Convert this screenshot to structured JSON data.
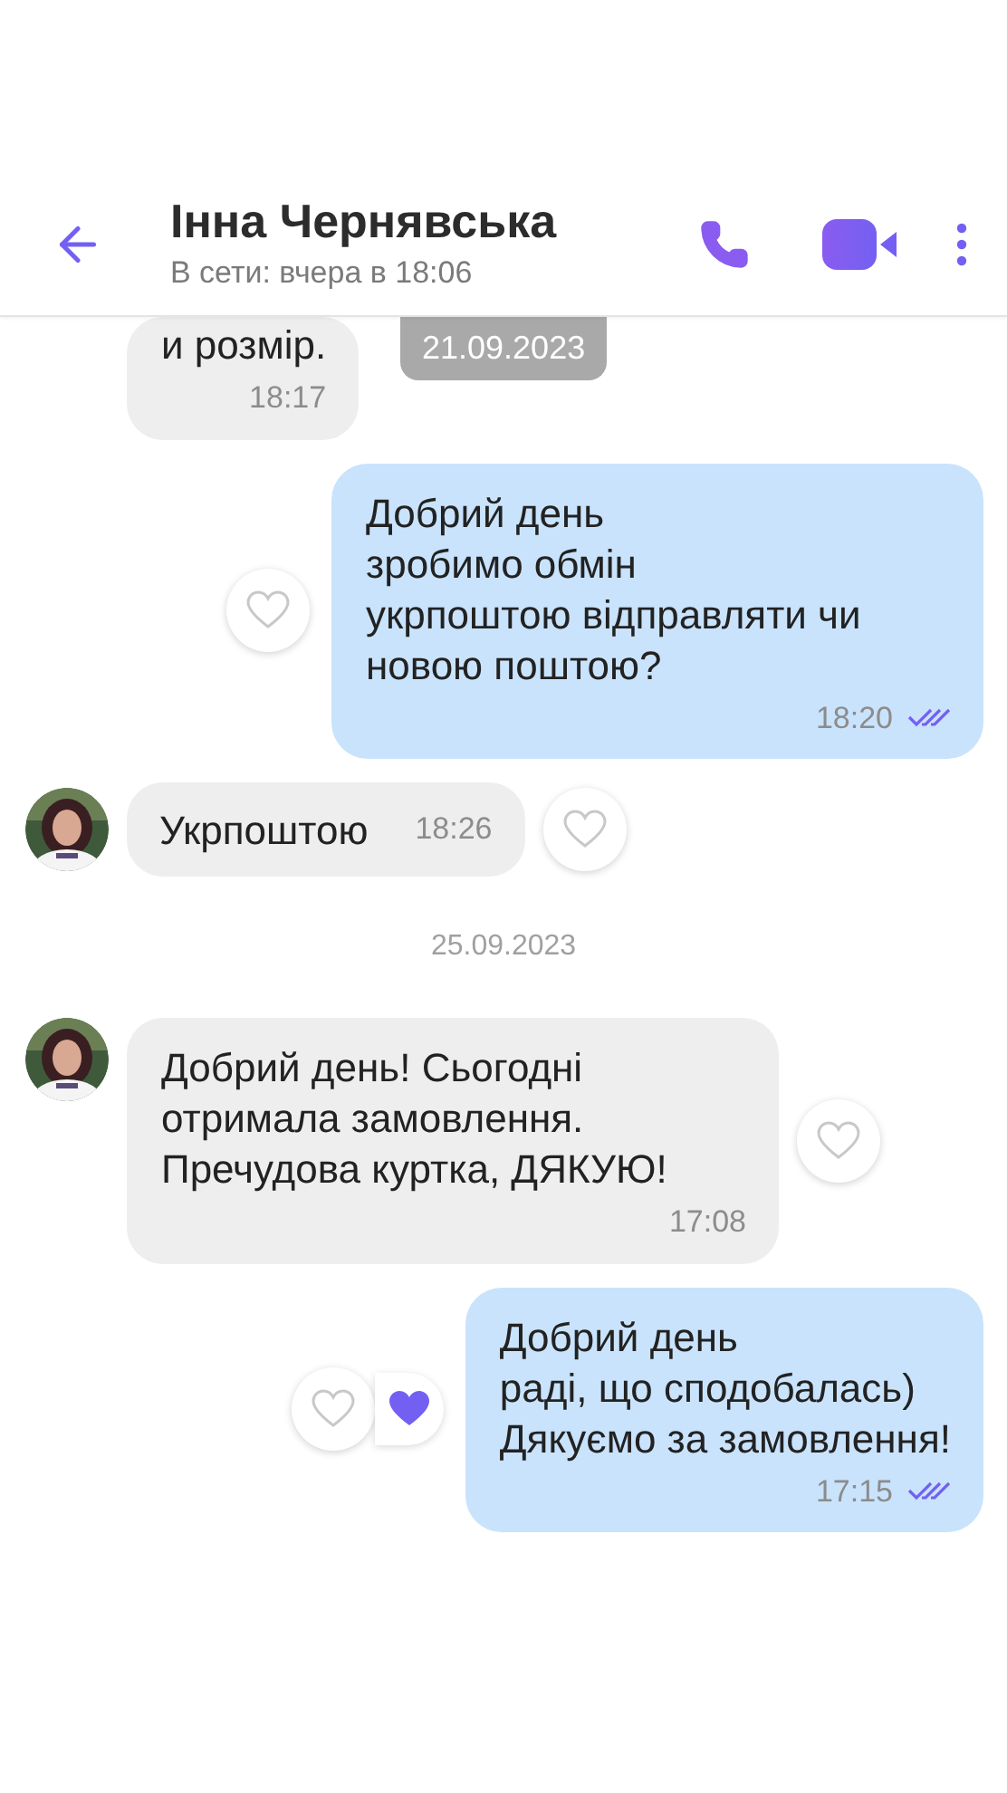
{
  "header": {
    "contact_name": "Інна Чернявська",
    "status": "В сети: вчера в 18:06"
  },
  "messages": [
    {
      "kind": "incoming",
      "text": "и розмір.",
      "time": "18:17",
      "date_overlay": "21.09.2023"
    },
    {
      "kind": "outgoing",
      "text": "Добрий день\nзробимо обмін\nукрпоштою відправляти чи новою поштою?",
      "time": "18:20",
      "read": true,
      "liked": false
    },
    {
      "kind": "incoming",
      "text": "Укрпоштою",
      "time": "18:26",
      "inline_time": true,
      "liked": false
    },
    {
      "kind": "date",
      "text": "25.09.2023"
    },
    {
      "kind": "incoming",
      "text": "Добрий день! Сьогодні отримала замовлення. Пречудова куртка, ДЯКУЮ!",
      "time": "17:08",
      "liked": false
    },
    {
      "kind": "outgoing",
      "text": "Добрий день\nраді, що сподобалась)\nДякуємо за замовлення!",
      "time": "17:15",
      "read": true,
      "liked": true
    }
  ]
}
